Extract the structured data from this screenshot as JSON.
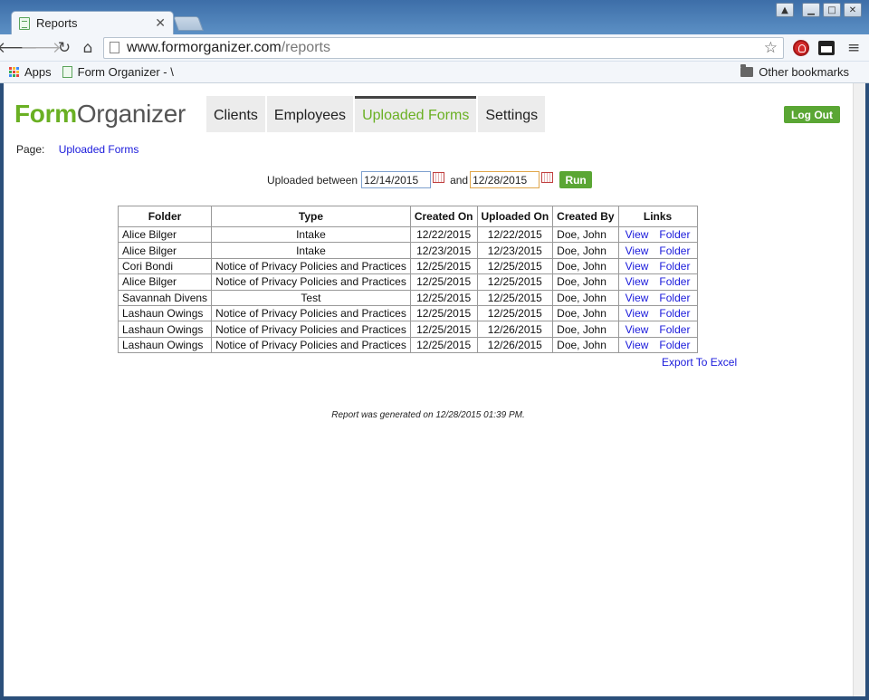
{
  "browser": {
    "tab_title": "Reports",
    "tab_close": "✕",
    "url_host": "www.formorganizer.com",
    "url_path": "/reports",
    "bookmarks": {
      "apps": "Apps",
      "form_organizer": "Form Organizer - \\",
      "other": "Other bookmarks"
    },
    "window_controls": [
      "▲",
      "▁",
      "□",
      "✕"
    ]
  },
  "app": {
    "logo_part1": "Form",
    "logo_part2": "Organizer",
    "nav": [
      "Clients",
      "Employees",
      "Uploaded Forms",
      "Settings"
    ],
    "active_nav": "Uploaded Forms",
    "logout_label": "Log Out",
    "accent_color": "#6ab023",
    "link_color": "#1a1adb"
  },
  "breadcrumb": {
    "label": "Page:",
    "page": "Uploaded Forms"
  },
  "filter": {
    "label": "Uploaded between",
    "start_date": "12/14/2015",
    "and_label": "and",
    "end_date": "12/28/2015",
    "run_label": "Run"
  },
  "table": {
    "headers": [
      "Folder",
      "Type",
      "Created On",
      "Uploaded On",
      "Created By",
      "Links"
    ],
    "rows": [
      [
        "Alice Bilger",
        "Intake",
        "12/22/2015",
        "12/22/2015",
        "Doe, John"
      ],
      [
        "Alice Bilger",
        "Intake",
        "12/23/2015",
        "12/23/2015",
        "Doe, John"
      ],
      [
        "Cori Bondi",
        "Notice of Privacy Policies and Practices",
        "12/25/2015",
        "12/25/2015",
        "Doe, John"
      ],
      [
        "Alice Bilger",
        "Notice of Privacy Policies and Practices",
        "12/25/2015",
        "12/25/2015",
        "Doe, John"
      ],
      [
        "Savannah Divens",
        "Test",
        "12/25/2015",
        "12/25/2015",
        "Doe, John"
      ],
      [
        "Lashaun Owings",
        "Notice of Privacy Policies and Practices",
        "12/25/2015",
        "12/25/2015",
        "Doe, John"
      ],
      [
        "Lashaun Owings",
        "Notice of Privacy Policies and Practices",
        "12/25/2015",
        "12/26/2015",
        "Doe, John"
      ],
      [
        "Lashaun Owings",
        "Notice of Privacy Policies and Practices",
        "12/25/2015",
        "12/26/2015",
        "Doe, John"
      ]
    ],
    "link_view": "View",
    "link_folder": "Folder"
  },
  "export_label": "Export To Excel",
  "footnote": "Report was generated on 12/28/2015 01:39 PM."
}
